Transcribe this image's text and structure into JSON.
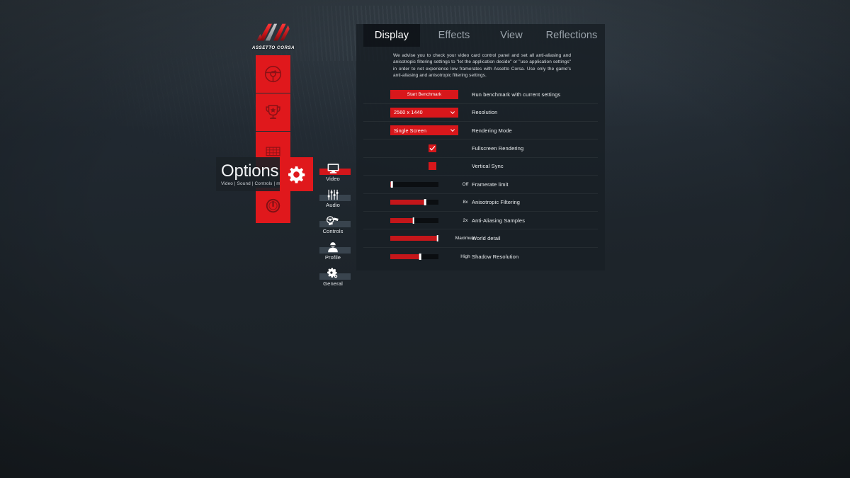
{
  "app": {
    "logo_word": "ASSETTO CORSA"
  },
  "command_strip": {
    "buttons": [
      {
        "name": "drive-button",
        "icon": "steering-wheel-icon"
      },
      {
        "name": "career-button",
        "icon": "trophy-icon"
      },
      {
        "name": "garage-button",
        "icon": "grid-garage-icon"
      }
    ],
    "power": {
      "name": "quit-button",
      "icon": "power-icon"
    }
  },
  "options_banner": {
    "title": "Options",
    "subtitle": "Video | Sound | Controls | more",
    "gear_icon": "gear-icon"
  },
  "categories": [
    {
      "label": "Video",
      "icon": "monitor-icon",
      "active": true
    },
    {
      "label": "Audio",
      "icon": "sliders-icon",
      "active": false
    },
    {
      "label": "Controls",
      "icon": "wheel-pedals-icon",
      "active": false
    },
    {
      "label": "Profile",
      "icon": "person-icon",
      "active": false
    },
    {
      "label": "General",
      "icon": "gear-small-icon",
      "active": false
    }
  ],
  "panel": {
    "tabs": [
      {
        "label": "Display",
        "active": true
      },
      {
        "label": "Effects",
        "active": false
      },
      {
        "label": "View",
        "active": false
      },
      {
        "label": "Reflections",
        "active": false
      }
    ],
    "advice": "We advise you to check your video card control panel and set all anti-aliasing and anisotropic filtering settings to \"let the application decide\" or \"use application settings\" in order to not experience low framerates with Assetto Corsa. Use only the game's anti-aliasing and anisotropic filtering settings.",
    "rows": [
      {
        "type": "button",
        "control_label": "Start Benchmark",
        "label": "Run benchmark with current settings"
      },
      {
        "type": "dropdown",
        "value": "2560 x 1440",
        "label": "Resolution"
      },
      {
        "type": "dropdown",
        "value": "Single Screen",
        "label": "Rendering Mode"
      },
      {
        "type": "checkbox",
        "checked": true,
        "label": "Fullscreen Rendering"
      },
      {
        "type": "checkbox",
        "checked": false,
        "label": "Vertical Sync"
      },
      {
        "type": "slider",
        "value_text": "Off",
        "fill_percent": 3,
        "label": "Framerate limit"
      },
      {
        "type": "slider",
        "value_text": "8x",
        "fill_percent": 72,
        "label": "Anisotropic Filtering"
      },
      {
        "type": "slider",
        "value_text": "2x",
        "fill_percent": 48,
        "label": "Anti-Aliasing Samples"
      },
      {
        "type": "slider",
        "value_text": "Maximum",
        "fill_percent": 98,
        "label": "World detail"
      },
      {
        "type": "slider",
        "value_text": "High",
        "fill_percent": 62,
        "label": "Shadow Resolution"
      }
    ]
  },
  "colors": {
    "accent_red": "#d8171b",
    "panel_bg": "#191f25",
    "page_bg": "#1e252b",
    "nav_inactive_bar": "#39444e"
  }
}
